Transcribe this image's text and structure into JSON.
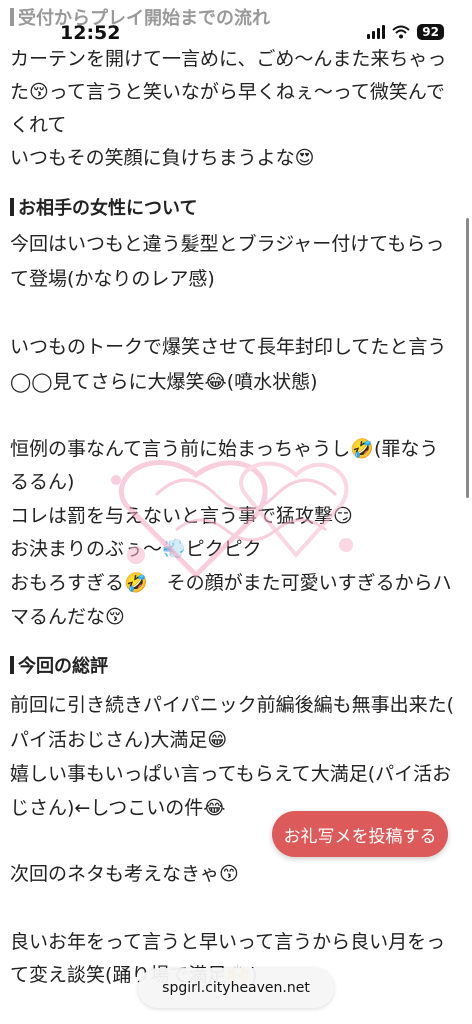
{
  "status_bar": {
    "time": "12:52",
    "battery": "92"
  },
  "sections": [
    {
      "heading": "受付からプレイ開始までの流れ",
      "lines": [
        "カーテンを開けて一言めに、ごめ〜んまた来ちゃっ",
        "た😚って言うと笑いながら早くねぇ〜って微笑んで",
        "くれて",
        "いつもその笑顔に負けちまうよな😍"
      ]
    },
    {
      "heading": "お相手の女性について",
      "lines": [
        "今回はいつもと違う髪型とブラジャー付けてもらっ",
        "て登場(かなりのレア感)",
        "いつものトークで爆笑させて長年封印してたと言う",
        "◯◯見てさらに大爆笑😂(噴水状態)",
        "恒例の事なんて言う前に始まっちゃうし🤣(罪なう",
        "るるん)",
        "コレは罰を与えないと言う事で猛攻撃😏",
        "お決まりのぶぅ〜💨ピクピク",
        "おもろすぎる🤣　その顔がまた可愛いすぎるからハ",
        "マるんだな😚"
      ]
    },
    {
      "heading": "今回の総評",
      "lines": [
        "前回に引き続きパイパニック前編後編も無事出来た(",
        "パイ活おじさん)大満足😁",
        "嬉しい事もいっぱい言ってもらえて大満足(パイ活お",
        "じさん)←しつこいの件😂",
        "次回のネタも考えなきゃ😙",
        "良いお年をって言うと早いって言うから良い月をっ",
        "て変え談笑(踊り場で満足🙌)"
      ]
    }
  ],
  "watermark_text": "ありがとうの気持ちが伝わるカタチ",
  "post_button_label": "お礼写メを投稿する",
  "url": "spgirl.cityheaven.net"
}
